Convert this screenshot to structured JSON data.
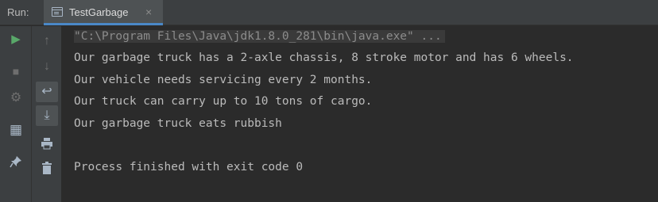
{
  "run_label": "Run:",
  "tab": {
    "title": "TestGarbage",
    "close": "×"
  },
  "toolbar_primary": [
    {
      "name": "rerun-icon",
      "glyph": "▶",
      "color": "#59a869"
    },
    {
      "name": "stop-icon",
      "glyph": "■",
      "color": "#6e6e6e"
    },
    {
      "name": "debug-settings-icon",
      "glyph": "⚙",
      "color": "#6e6e6e"
    },
    {
      "name": "layout-icon",
      "glyph": "▦",
      "color": "#a9b7c6"
    },
    {
      "name": "pin-icon",
      "glyph": "📌",
      "color": "#a9b7c6"
    }
  ],
  "toolbar_secondary": [
    {
      "name": "scroll-up-icon",
      "glyph": "↑",
      "color": "#6e6e6e"
    },
    {
      "name": "scroll-down-icon",
      "glyph": "↓",
      "color": "#6e6e6e"
    },
    {
      "name": "soft-wrap-icon",
      "glyph": "↩",
      "color": "#a9b7c6"
    },
    {
      "name": "scroll-to-end-icon",
      "glyph": "⤓",
      "color": "#a9b7c6"
    },
    {
      "name": "print-icon",
      "glyph": "⎙",
      "color": "#a9b7c6"
    },
    {
      "name": "trash-icon",
      "glyph": "🗑",
      "color": "#a9b7c6"
    }
  ],
  "console": {
    "command": "\"C:\\Program Files\\Java\\jdk1.8.0_281\\bin\\java.exe\" ...",
    "output": [
      "Our garbage truck has a 2-axle chassis, 8 stroke motor and has 6 wheels.",
      "Our vehicle needs servicing every 2 months.",
      "Our truck can carry up to 10 tons of cargo.",
      "Our garbage truck eats rubbish"
    ],
    "exit_message": "Process finished with exit code 0"
  }
}
